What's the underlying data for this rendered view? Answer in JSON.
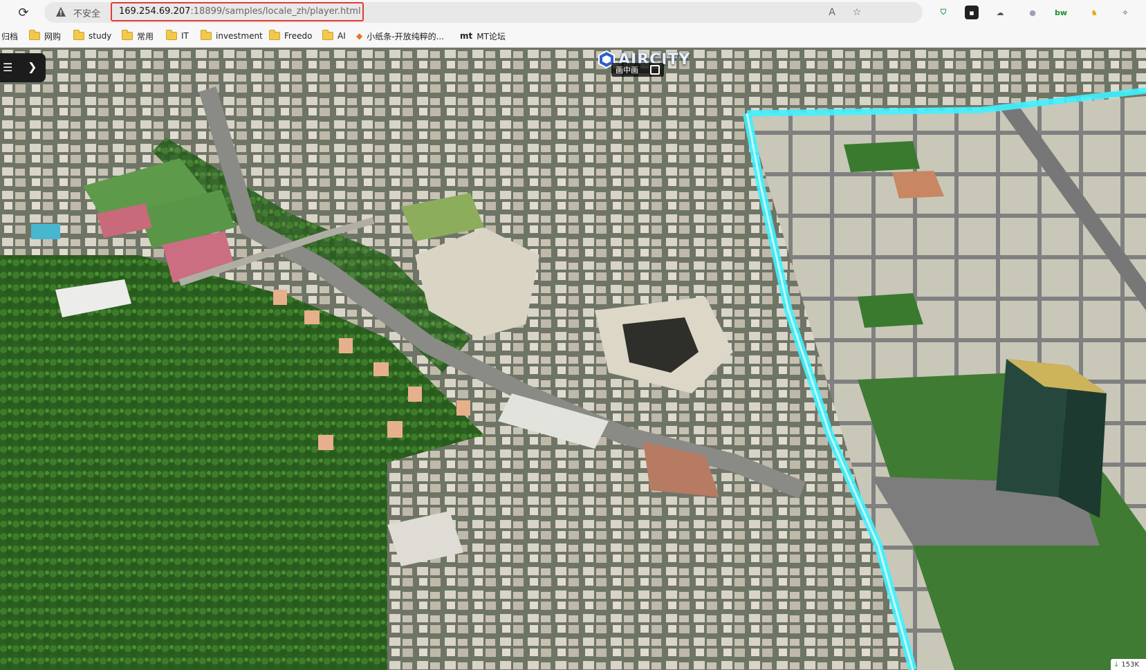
{
  "browser": {
    "insecure_label": "不安全",
    "url_host": "169.254.69.207",
    "url_rest": ":18899/samples/locale_zh/player.html"
  },
  "bookmarks": [
    {
      "label": "归档",
      "icon": "none"
    },
    {
      "label": "网购",
      "icon": "folder-icon"
    },
    {
      "label": "study",
      "icon": "folder-icon"
    },
    {
      "label": "常用",
      "icon": "folder-icon"
    },
    {
      "label": "IT",
      "icon": "folder-icon"
    },
    {
      "label": "investment",
      "icon": "folder-icon"
    },
    {
      "label": "Freedo",
      "icon": "folder-icon"
    },
    {
      "label": "AI",
      "icon": "folder-icon"
    },
    {
      "label": "小纸条-开放纯粹的...",
      "icon": "fox-icon"
    },
    {
      "label": "MT论坛",
      "icon": "mt-icon"
    }
  ],
  "player": {
    "logo_text": "AIRCITY",
    "pip_label": "画中画"
  },
  "status": {
    "download_badge": "153K"
  },
  "colors": {
    "highlight_border": "#e53935",
    "cyan_boundary": "#3ff2ff",
    "foliage": "#2f6b22"
  }
}
